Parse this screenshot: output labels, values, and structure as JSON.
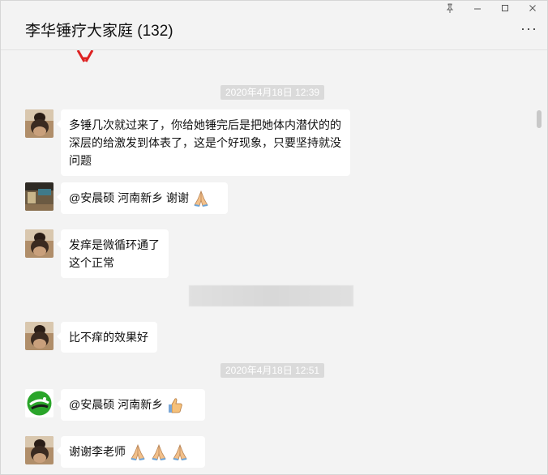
{
  "window": {
    "title": "李华锤疗大家庭 (132)",
    "controls": [
      "pin-icon",
      "minimize-icon",
      "maximize-icon",
      "close-icon"
    ],
    "more_icon": "more-horizontal-icon"
  },
  "messages": [
    {
      "type": "timestamp",
      "text": "2020年4月18日 12:39"
    },
    {
      "type": "message",
      "avatar": "bun-hair-avatar",
      "lines": [
        "多锤几次就过来了，你给她锤完后是把她体内潜伏的的",
        "深层的给激发到体表了，这是个好现象，只要坚持就没",
        "问题"
      ]
    },
    {
      "type": "message",
      "avatar": "room-avatar",
      "lines": [
        "@安晨硕   河南新乡 谢谢"
      ],
      "emoji": [
        "praying-hands-icon"
      ]
    },
    {
      "type": "message",
      "avatar": "bun-hair-avatar",
      "lines": [
        "发痒是微循环通了",
        "这个正常"
      ]
    },
    {
      "type": "redacted"
    },
    {
      "type": "message",
      "avatar": "bun-hair-avatar",
      "lines": [
        "比不痒的效果好"
      ]
    },
    {
      "type": "timestamp",
      "text": "2020年4月18日 12:51"
    },
    {
      "type": "message",
      "avatar": "green-logo-avatar",
      "lines": [
        "@安晨硕   河南新乡"
      ],
      "emoji": [
        "thumbs-up-icon"
      ]
    },
    {
      "type": "message",
      "avatar": "bun-hair-avatar",
      "lines": [
        "谢谢李老师"
      ],
      "emoji": [
        "praying-hands-icon",
        "praying-hands-icon",
        "praying-hands-icon"
      ]
    }
  ],
  "colors": {
    "background": "#f3f3f3",
    "bubble": "#ffffff",
    "timestamp_bg": "#dadada",
    "logo_green": "#2aa52a"
  }
}
